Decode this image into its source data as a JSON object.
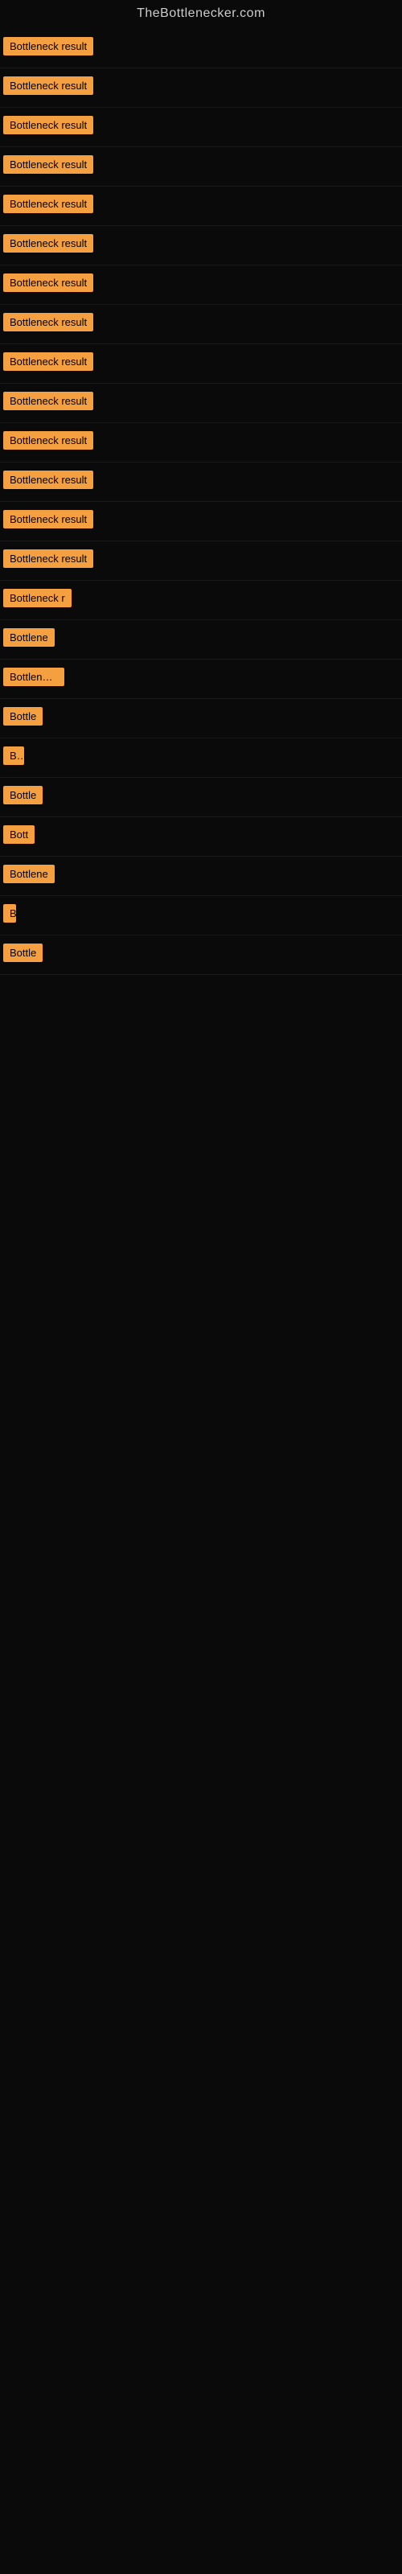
{
  "site": {
    "title": "TheBottlenecker.com"
  },
  "badges": [
    {
      "label": "Bottleneck result",
      "width": 120
    },
    {
      "label": "Bottleneck result",
      "width": 120
    },
    {
      "label": "Bottleneck result",
      "width": 120
    },
    {
      "label": "Bottleneck result",
      "width": 120
    },
    {
      "label": "Bottleneck result",
      "width": 120
    },
    {
      "label": "Bottleneck result",
      "width": 120
    },
    {
      "label": "Bottleneck result",
      "width": 120
    },
    {
      "label": "Bottleneck result",
      "width": 120
    },
    {
      "label": "Bottleneck result",
      "width": 120
    },
    {
      "label": "Bottleneck result",
      "width": 120
    },
    {
      "label": "Bottleneck result",
      "width": 120
    },
    {
      "label": "Bottleneck result",
      "width": 117
    },
    {
      "label": "Bottleneck result",
      "width": 120
    },
    {
      "label": "Bottleneck result",
      "width": 117
    },
    {
      "label": "Bottleneck r",
      "width": 88
    },
    {
      "label": "Bottlene",
      "width": 68
    },
    {
      "label": "Bottleneck",
      "width": 76
    },
    {
      "label": "Bottle",
      "width": 50
    },
    {
      "label": "Bo",
      "width": 26
    },
    {
      "label": "Bottle",
      "width": 52
    },
    {
      "label": "Bott",
      "width": 40
    },
    {
      "label": "Bottlene",
      "width": 65
    },
    {
      "label": "B",
      "width": 16
    },
    {
      "label": "Bottle",
      "width": 50
    }
  ]
}
